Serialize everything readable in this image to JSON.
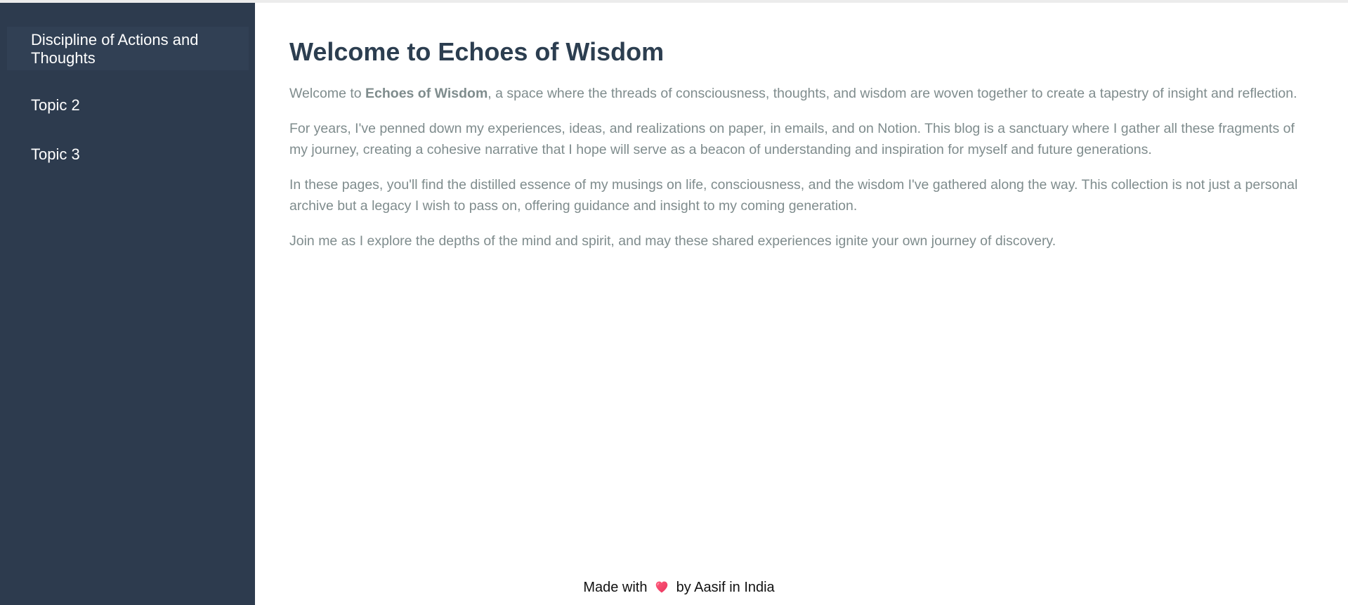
{
  "sidebar": {
    "items": [
      {
        "label": "Discipline of Actions and Thoughts"
      },
      {
        "label": "Topic 2"
      },
      {
        "label": "Topic 3"
      }
    ]
  },
  "main": {
    "title": "Welcome to Echoes of Wisdom",
    "intro": {
      "prefix": "Welcome to ",
      "brand": "Echoes of Wisdom",
      "suffix": ", a space where the threads of consciousness, thoughts, and wisdom are woven together to create a tapestry of insight and reflection."
    },
    "paragraphs": [
      "For years, I've penned down my experiences, ideas, and realizations on paper, in emails, and on Notion. This blog is a sanctuary where I gather all these fragments of my journey, creating a cohesive narrative that I hope will serve as a beacon of understanding and inspiration for myself and future generations.",
      "In these pages, you'll find the distilled essence of my musings on life, consciousness, and the wisdom I've gathered along the way. This collection is not just a personal archive but a legacy I wish to pass on, offering guidance and insight to my coming generation.",
      "Join me as I explore the depths of the mind and spirit, and may these shared experiences ignite your own journey of discovery."
    ]
  },
  "footer": {
    "prefix": "Made with",
    "heart_icon": "heart-icon",
    "suffix": "by Aasif in India"
  },
  "colors": {
    "sidebar_bg": "#2d3b4e",
    "title": "#2c3e50",
    "body_text": "#7f8c8d",
    "heart": "#e8335d"
  }
}
